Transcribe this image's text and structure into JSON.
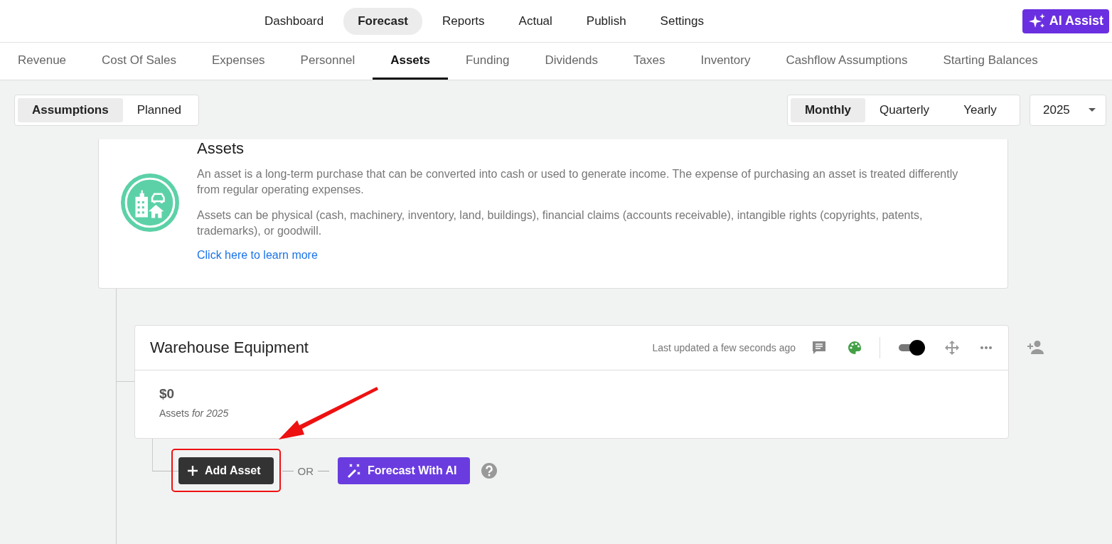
{
  "top_nav": [
    {
      "label": "Dashboard",
      "selected": false
    },
    {
      "label": "Forecast",
      "selected": true
    },
    {
      "label": "Reports",
      "selected": false
    },
    {
      "label": "Actual",
      "selected": false
    },
    {
      "label": "Publish",
      "selected": false
    },
    {
      "label": "Settings",
      "selected": false
    }
  ],
  "ai_assist_button": "AI Assist",
  "sub_tabs": [
    {
      "label": "Revenue",
      "selected": false
    },
    {
      "label": "Cost Of Sales",
      "selected": false
    },
    {
      "label": "Expenses",
      "selected": false
    },
    {
      "label": "Personnel",
      "selected": false
    },
    {
      "label": "Assets",
      "selected": true
    },
    {
      "label": "Funding",
      "selected": false
    },
    {
      "label": "Dividends",
      "selected": false
    },
    {
      "label": "Taxes",
      "selected": false
    },
    {
      "label": "Inventory",
      "selected": false
    },
    {
      "label": "Cashflow Assumptions",
      "selected": false
    },
    {
      "label": "Starting Balances",
      "selected": false
    }
  ],
  "view_toggle": [
    {
      "label": "Assumptions",
      "selected": true
    },
    {
      "label": "Planned",
      "selected": false
    }
  ],
  "period_toggle": [
    {
      "label": "Monthly",
      "selected": true
    },
    {
      "label": "Quarterly",
      "selected": false
    },
    {
      "label": "Yearly",
      "selected": false
    }
  ],
  "year_select": "2025",
  "info_card": {
    "title": "Assets",
    "paragraphs": [
      "An asset is a long-term purchase that can be converted into cash or used to generate income. The expense of purchasing an asset is treated differently from regular operating expenses.",
      "Assets can be physical (cash, machinery, inventory, land, buildings), financial claims (accounts receivable), intangible rights (copyrights, patents, trademarks), or goodwill."
    ],
    "link": "Click here to learn more"
  },
  "block": {
    "title": "Warehouse Equipment",
    "last_updated": "Last updated a few seconds ago",
    "toggle_on": true,
    "total": "$0",
    "total_label": "Assets *for 2025*"
  },
  "add_button": "Add Asset",
  "or_label": "OR",
  "ai_button": "Forecast With AI"
}
